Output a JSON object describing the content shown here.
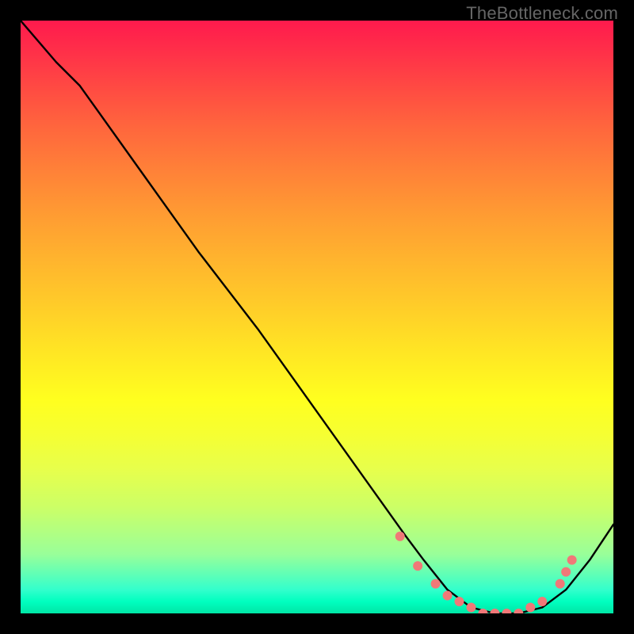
{
  "watermark": "TheBottleneck.com",
  "chart_data": {
    "type": "line",
    "title": "",
    "xlabel": "",
    "ylabel": "",
    "xlim": [
      0,
      100
    ],
    "ylim": [
      0,
      100
    ],
    "grid": false,
    "series": [
      {
        "name": "curve",
        "x": [
          0,
          6,
          10,
          20,
          30,
          40,
          50,
          60,
          65,
          68,
          72,
          76,
          80,
          84,
          88,
          92,
          96,
          100
        ],
        "y": [
          100,
          93,
          89,
          75,
          61,
          48,
          34,
          20,
          13,
          9,
          4,
          1,
          0,
          0,
          1,
          4,
          9,
          15
        ],
        "color": "#000000"
      }
    ],
    "markers": {
      "comment": "salmon dots along the valley region",
      "x": [
        64,
        67,
        70,
        72,
        74,
        76,
        78,
        80,
        82,
        84,
        86,
        88,
        91,
        92,
        93
      ],
      "y": [
        13,
        8,
        5,
        3,
        2,
        1,
        0,
        0,
        0,
        0,
        1,
        2,
        5,
        7,
        9
      ],
      "color": "#f07878",
      "radius": 6
    }
  }
}
